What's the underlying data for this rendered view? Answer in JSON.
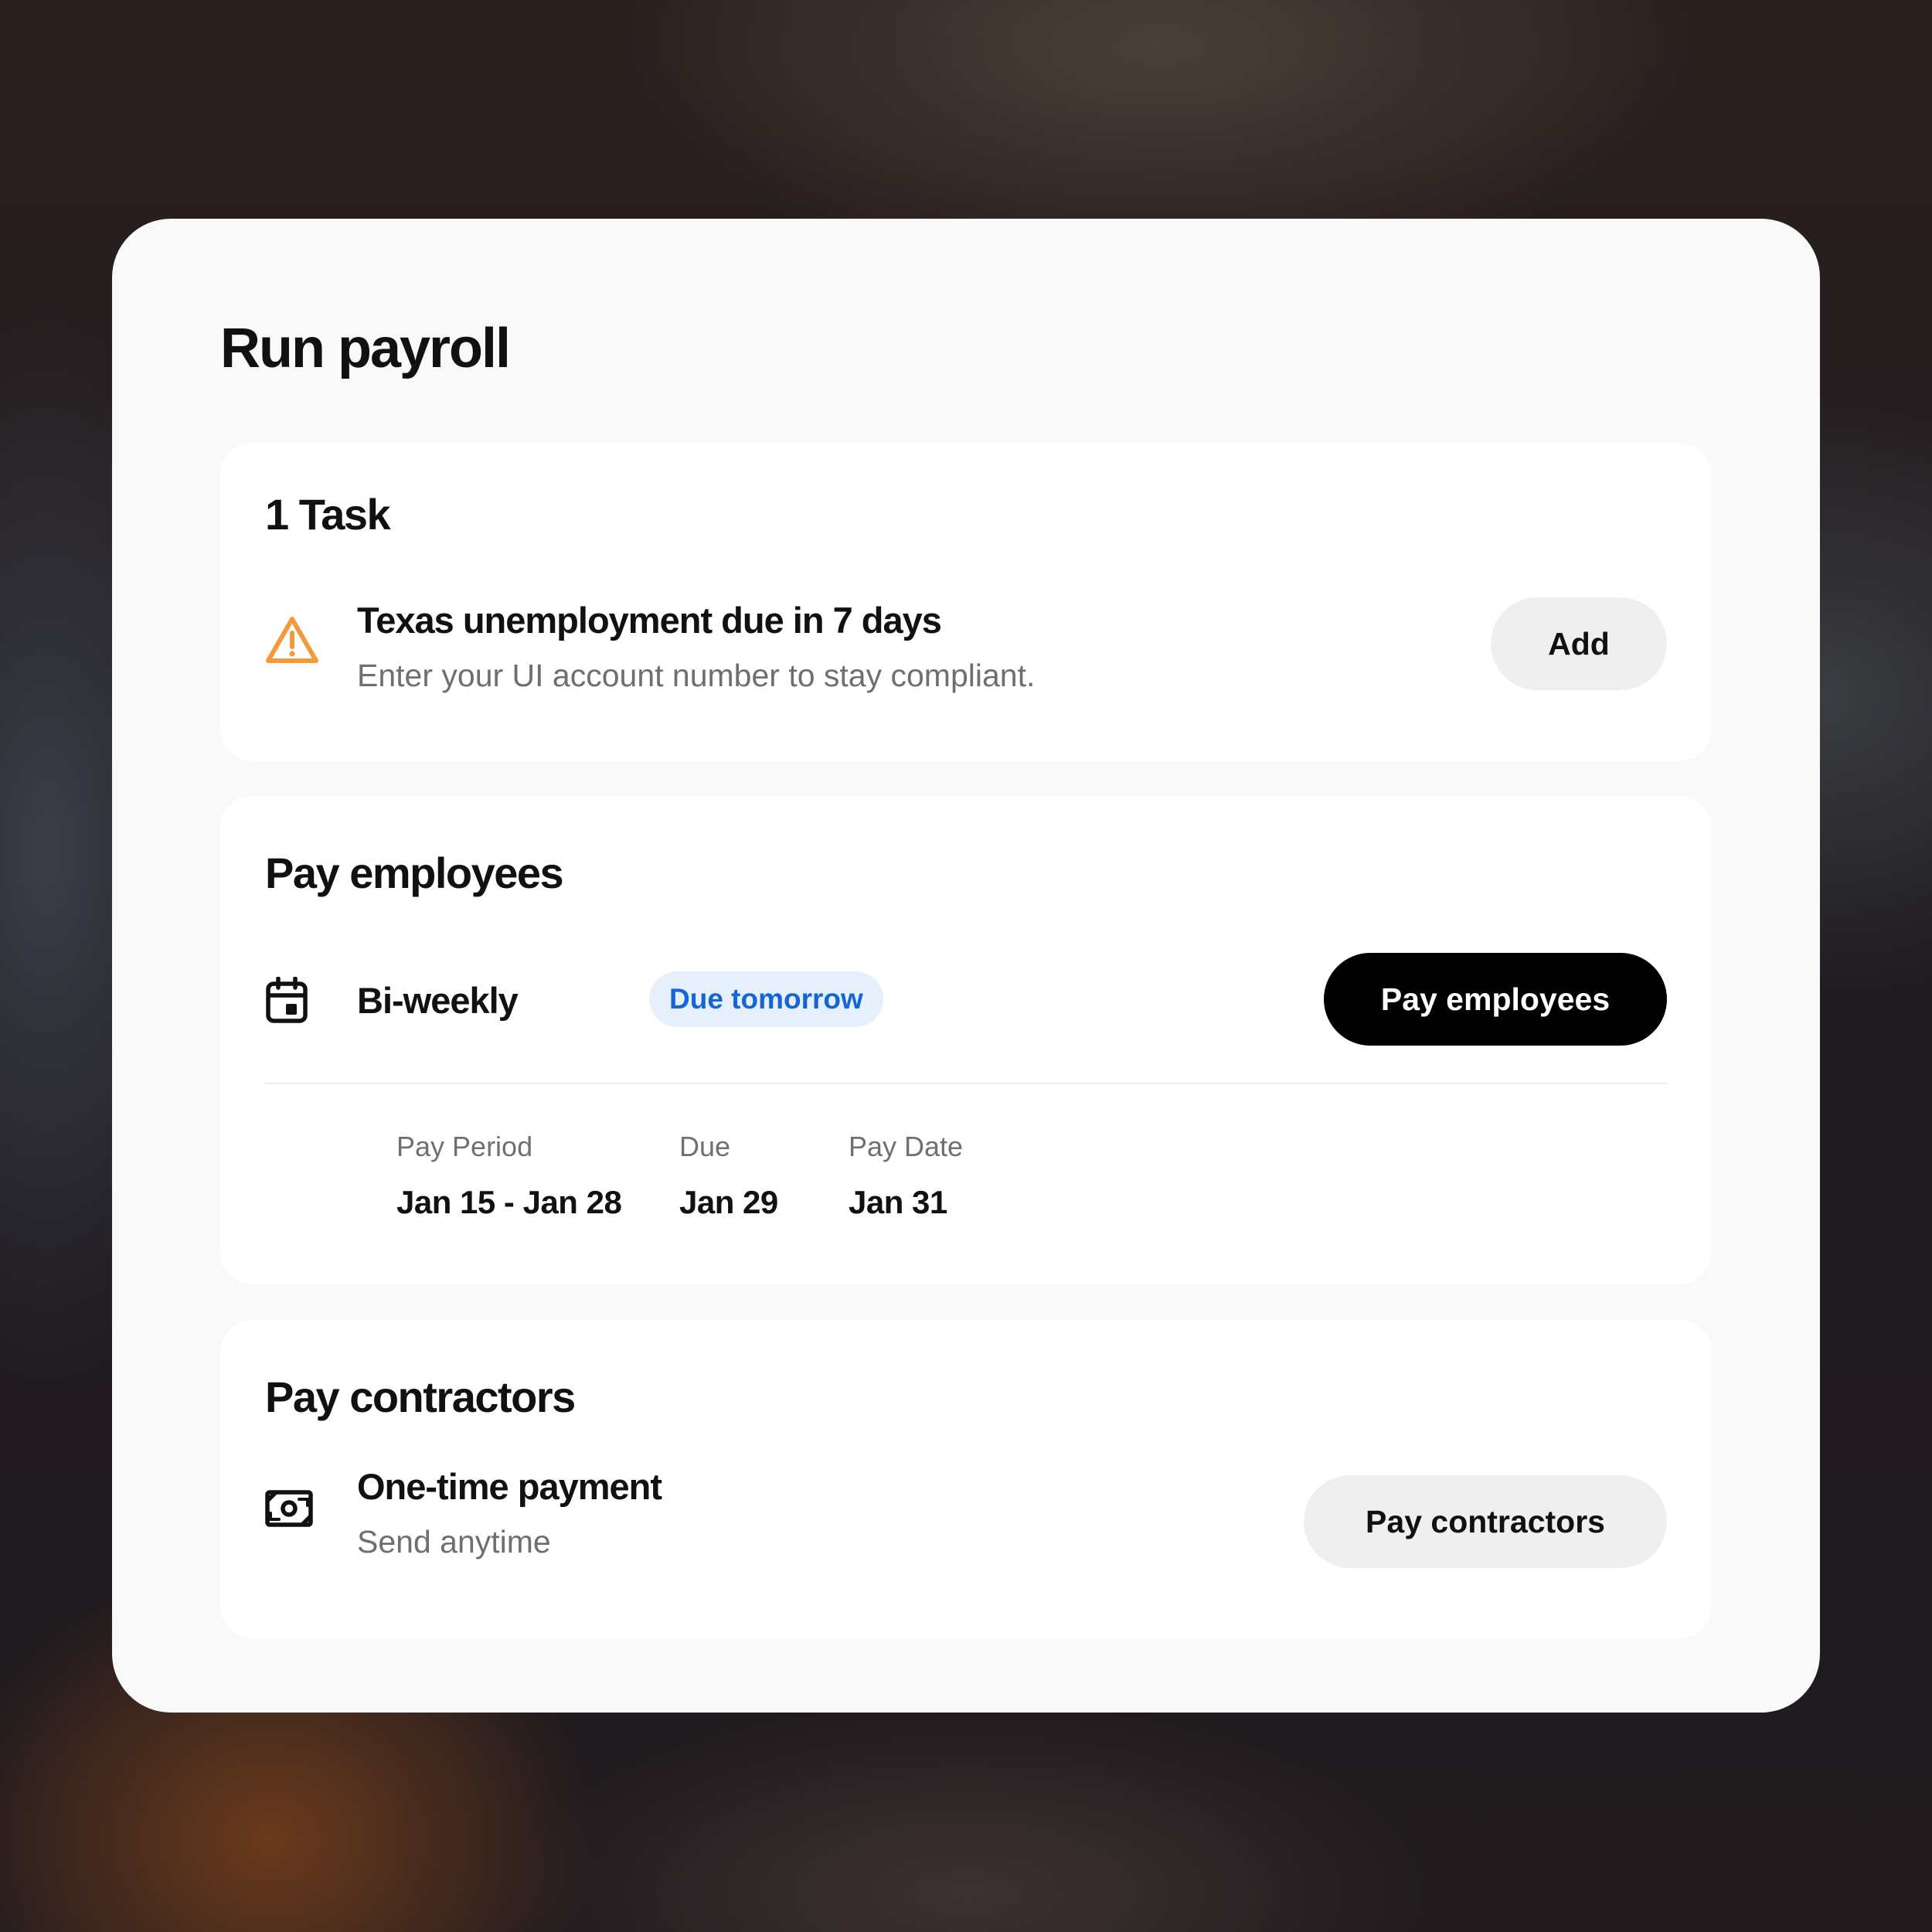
{
  "title": "Run payroll",
  "tasks": {
    "heading": "1 Task",
    "item": {
      "icon": "warning-triangle-icon",
      "title": "Texas unemployment due in 7 days",
      "subtitle": "Enter your UI account number to stay compliant.",
      "button": "Add"
    }
  },
  "pay_employees": {
    "heading": "Pay employees",
    "icon": "calendar-icon",
    "schedule": "Bi-weekly",
    "badge": "Due tomorrow",
    "button": "Pay employees",
    "columns": [
      {
        "label": "Pay Period",
        "value": "Jan 15 - Jan 28"
      },
      {
        "label": "Due",
        "value": "Jan 29"
      },
      {
        "label": "Pay Date",
        "value": "Jan 31"
      }
    ]
  },
  "pay_contractors": {
    "heading": "Pay contractors",
    "icon": "cash-icon",
    "title": "One-time payment",
    "subtitle": "Send anytime",
    "button": "Pay contractors"
  },
  "colors": {
    "warning": "#f39a3c",
    "badge_bg": "#e5f0fc",
    "badge_text": "#1565d8",
    "primary_button": "#000000"
  }
}
